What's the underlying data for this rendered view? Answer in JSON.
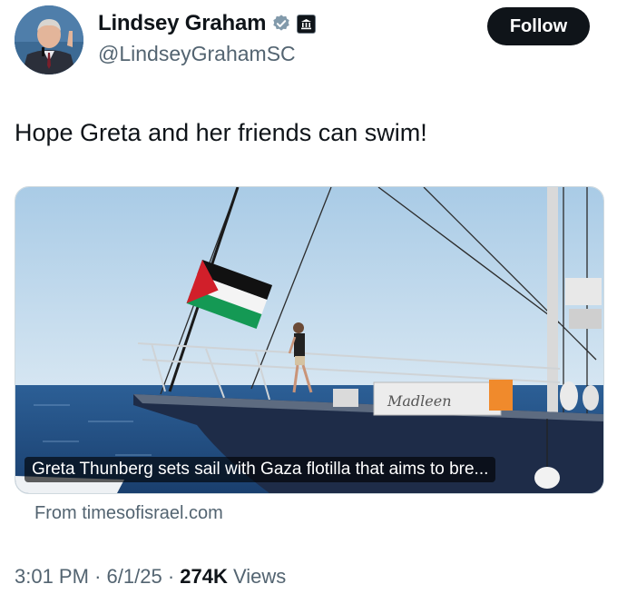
{
  "author": {
    "name": "Lindsey Graham",
    "handle": "@LindseyGrahamSC",
    "verified_badge_icon": "verified-check-icon",
    "affiliation_badge_icon": "government-building-icon"
  },
  "follow_button": {
    "label": "Follow"
  },
  "tweet": {
    "text": "Hope Greta and her friends can swim!"
  },
  "link_card": {
    "image_caption": "Greta Thunberg sets sail with Gaza flotilla that aims to bre...",
    "boat_name_on_image": "Madleen",
    "source": "From timesofisrael.com"
  },
  "meta": {
    "time": "3:01 PM",
    "sep1": "·",
    "date": "6/1/25",
    "sep2": "·",
    "views_count": "274K",
    "views_label": "Views"
  },
  "colors": {
    "text_primary": "#0f1419",
    "text_secondary": "#536471",
    "verified_blue": "#1d9bf0",
    "follow_bg": "#0f1419"
  }
}
